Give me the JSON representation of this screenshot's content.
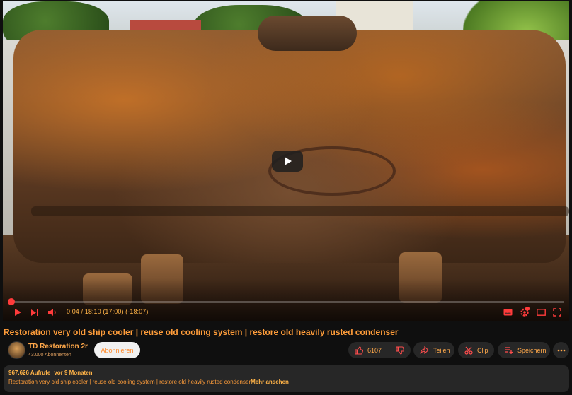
{
  "player": {
    "time_display": "0:04 / 18:10 (17:00) (-18:07)",
    "progress": 0.004,
    "colors": {
      "progress": "#ff3b3b",
      "accent_text": "#ffa84a"
    }
  },
  "video": {
    "title": "Restoration very old ship cooler | reuse old cooling system | restore old heavily rusted condenser"
  },
  "channel": {
    "name": "TD Restoration 2r",
    "subscribers": "43.000 Abonnenten",
    "subscribe_label": "Abonnieren"
  },
  "actions": {
    "like_count": "6107",
    "share_label": "Teilen",
    "clip_label": "Clip",
    "save_label": "Speichern"
  },
  "description": {
    "views": "967.626 Aufrufe",
    "age": "vor 9 Monaten",
    "text": "Restoration very old ship cooler | reuse old cooling system | restore old heavily rusted condenser",
    "more_label": "Mehr ansehen"
  },
  "icons": [
    "play-icon",
    "next-icon",
    "volume-icon",
    "subtitles-icon",
    "settings-icon",
    "miniplayer-icon",
    "fullscreen-icon",
    "like-icon",
    "dislike-icon",
    "share-icon",
    "scissors-icon",
    "save-icon",
    "more-icon"
  ]
}
